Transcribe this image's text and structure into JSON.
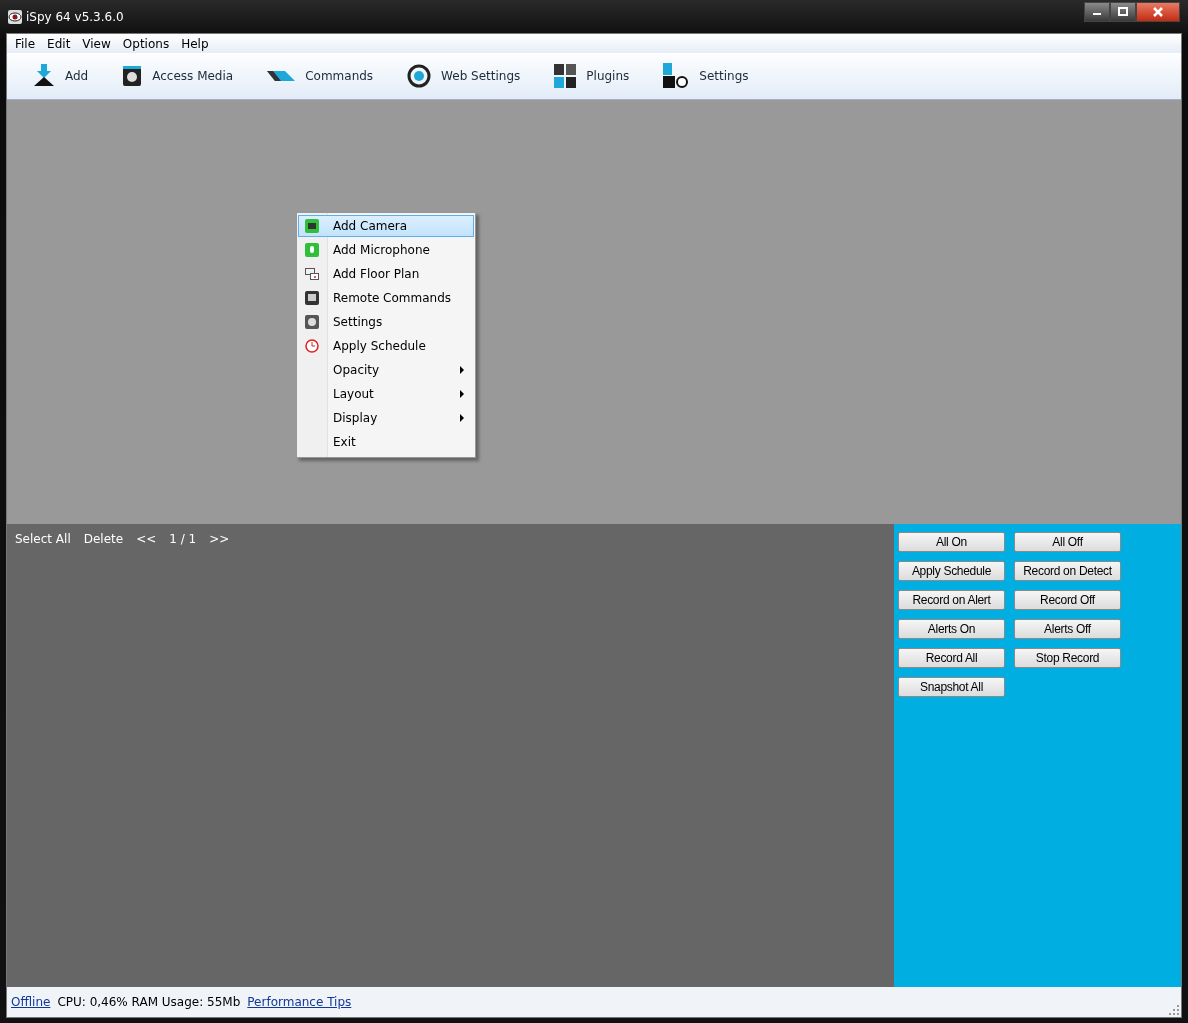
{
  "window": {
    "title": "iSpy 64 v5.3.6.0"
  },
  "menu_bar": [
    "File",
    "Edit",
    "View",
    "Options",
    "Help"
  ],
  "toolbar": [
    "Add",
    "Access Media",
    "Commands",
    "Web Settings",
    "Plugins",
    "Settings"
  ],
  "context_menu": [
    {
      "label": "Add Camera",
      "kind": "item",
      "selected": true
    },
    {
      "label": "Add Microphone",
      "kind": "item",
      "selected": false
    },
    {
      "label": "Add Floor Plan",
      "kind": "item",
      "selected": false
    },
    {
      "label": "Remote Commands",
      "kind": "item",
      "selected": false
    },
    {
      "label": "Settings",
      "kind": "item",
      "selected": false
    },
    {
      "label": "Apply Schedule",
      "kind": "item",
      "selected": false
    },
    {
      "label": "Opacity",
      "kind": "submenu",
      "selected": false
    },
    {
      "label": "Layout",
      "kind": "submenu",
      "selected": false
    },
    {
      "label": "Display",
      "kind": "submenu",
      "selected": false
    },
    {
      "label": "Exit",
      "kind": "item",
      "selected": false
    }
  ],
  "list_bar": [
    "Select All",
    "Delete",
    "<<",
    "1 / 1",
    ">>"
  ],
  "control_buttons": [
    "All On",
    "All Off",
    "Apply Schedule",
    "Record on Detect",
    "Record on Alert",
    "Record Off",
    "Alerts On",
    "Alerts Off",
    "Record All",
    "Stop Record",
    "Snapshot All"
  ],
  "status_bar": {
    "status_link": "Offline",
    "usage": "CPU: 0,46% RAM Usage: 55Mb",
    "tips_link": "Performance Tips"
  }
}
